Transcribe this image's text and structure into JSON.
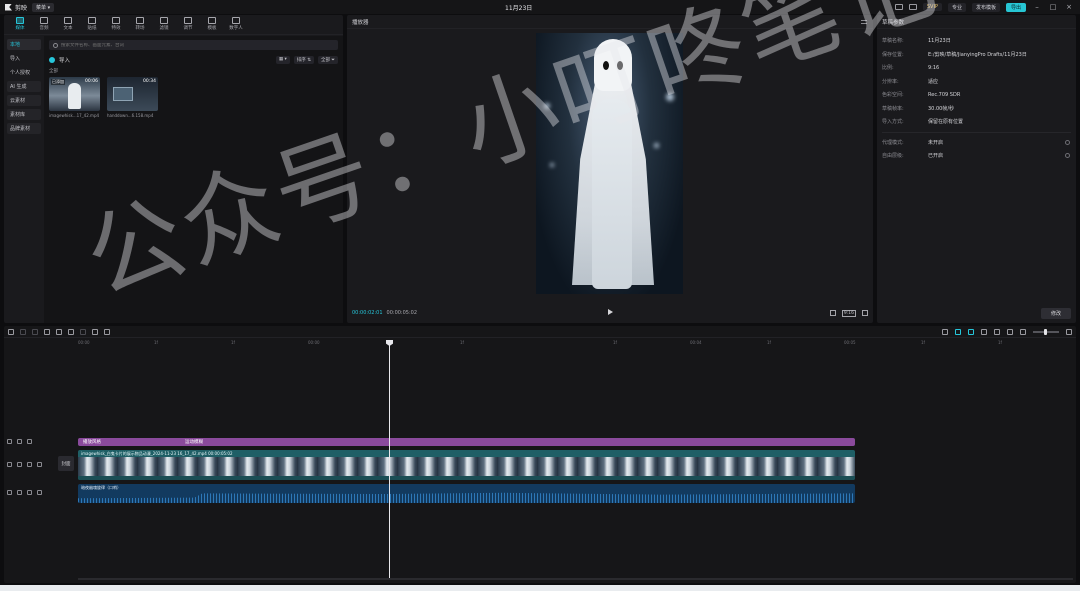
{
  "titlebar": {
    "app_name": "剪映",
    "menu_label": "菜单",
    "project_title": "11月23日",
    "svip": "SVIP",
    "pro": "专业",
    "publish": "发布模板",
    "export": "导出"
  },
  "toolbar": [
    {
      "label": "媒体",
      "active": true
    },
    {
      "label": "音频"
    },
    {
      "label": "文本"
    },
    {
      "label": "贴纸"
    },
    {
      "label": "特效"
    },
    {
      "label": "转场"
    },
    {
      "label": "滤镜"
    },
    {
      "label": "调节"
    },
    {
      "label": "模板"
    },
    {
      "label": "数字人"
    }
  ],
  "media": {
    "side_items": [
      {
        "label": "本地",
        "active": true
      },
      {
        "label": "导入"
      },
      {
        "label": "个人授权"
      },
      {
        "label": "AI 生成",
        "boxed": true
      },
      {
        "label": "云素材",
        "boxed": true
      },
      {
        "label": "素材库",
        "boxed": true
      },
      {
        "label": "品牌素材",
        "boxed": true
      }
    ],
    "search_placeholder": "搜索文件名称、画面元素、台词",
    "import_label": "导入",
    "sort_label": "排序",
    "all_label": "全部",
    "section_label": "全部",
    "items": [
      {
        "name": "imagewhisk...17_42.mp4",
        "duration": "00:06",
        "tag": "已添加",
        "kind": "ghost"
      },
      {
        "name": "handdown...6.158.mp4",
        "duration": "00:34",
        "tag": "",
        "kind": "phone"
      }
    ]
  },
  "player": {
    "title": "播放器",
    "time_current": "00:00:02:01",
    "time_total": "00:00:05:02",
    "ratio": "9:16"
  },
  "params": {
    "title": "草稿参数",
    "rows": [
      {
        "key": "草稿名称:",
        "value": "11月23日"
      },
      {
        "key": "保存位置:",
        "value": "E:/剪映/草稿/JianyingPro Drafts/11月23日"
      },
      {
        "key": "比例:",
        "value": "9:16"
      },
      {
        "key": "分辨率:",
        "value": "适应"
      },
      {
        "key": "色彩空间:",
        "value": "Rec.709 SDR"
      },
      {
        "key": "草稿帧率:",
        "value": "30.00帧/秒"
      },
      {
        "key": "导入方式:",
        "value": "保留在原有位置"
      }
    ],
    "rows2": [
      {
        "key": "代理模式:",
        "value": "未开启"
      },
      {
        "key": "自由层级:",
        "value": "已开启"
      }
    ],
    "modify_label": "修改"
  },
  "timeline": {
    "ruler": [
      "00:00",
      "1f",
      "1f",
      "00:00",
      "1f",
      "1f",
      "00:04",
      "1f",
      "00:05",
      "1f",
      "1f"
    ],
    "effect_clip": {
      "label1": "播放风格",
      "label2": "运动模糊"
    },
    "video_clip": {
      "label": "imagewhisk_白鬼卡片的展示物品动漫_2024-11-23 16_17_42.mp4   00:00:05:02"
    },
    "audio_clip": {
      "label": "暗夜幽魂旋律（口哨）"
    },
    "cover_label": "封面"
  },
  "watermark": "公众号：小叮咚笔记"
}
